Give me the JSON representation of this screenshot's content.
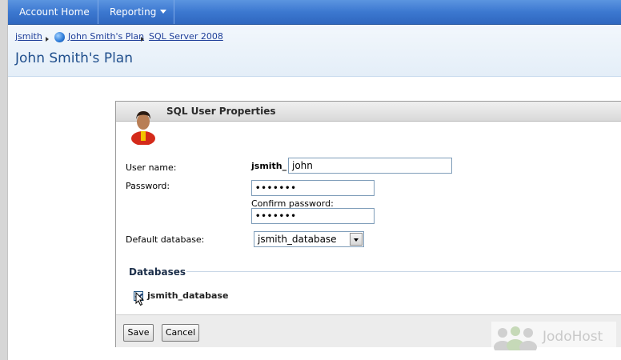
{
  "nav": {
    "items": [
      {
        "label": "Account Home"
      },
      {
        "label": "Reporting"
      }
    ]
  },
  "breadcrumb": {
    "items": [
      {
        "label": "jsmith"
      },
      {
        "label": "John Smith's Plan"
      },
      {
        "label": "SQL Server 2008"
      }
    ]
  },
  "page": {
    "title": "John Smith's Plan"
  },
  "dialog": {
    "title": "SQL User Properties",
    "username_label": "User name:",
    "username_prefix": "jsmith_",
    "username_value": "john",
    "password_label": "Password:",
    "password_value": "•••••••",
    "confirm_label": "Confirm password:",
    "confirm_value": "•••••••",
    "default_db_label": "Default database:",
    "default_db_value": "jsmith_database",
    "databases_heading": "Databases",
    "databases": [
      {
        "name": "jsmith_database",
        "checked": true
      }
    ],
    "save_label": "Save",
    "cancel_label": "Cancel"
  },
  "watermark": {
    "text": "JodoHost"
  },
  "colors": {
    "nav_bg": "#3c78d0",
    "title_blue": "#1f4e8c",
    "link_blue": "#1f3f99"
  }
}
